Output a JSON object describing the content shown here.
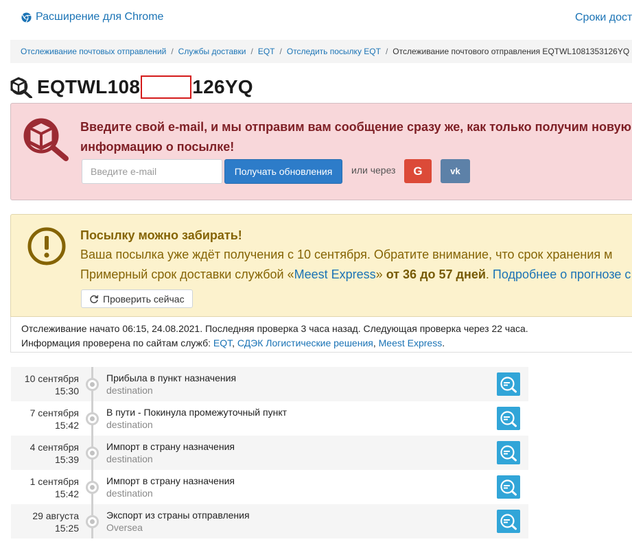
{
  "header": {
    "chrome_extension": "Расширение для Chrome",
    "terms_link": "Сроки доста"
  },
  "breadcrumb": {
    "items": [
      "Отслеживание почтовых отправлений",
      "Службы доставки",
      "EQT",
      "Отследить посылку EQT"
    ],
    "current": "Отслеживание почтового отправления EQTWL1081353126YQ"
  },
  "title": {
    "prefix": "EQTWL108",
    "suffix": "126YQ"
  },
  "subscribe": {
    "message": "Введите свой e-mail, и мы отправим вам сообщение сразу же, как только получим новую информацию о посылке!",
    "email_placeholder": "Введите e-mail",
    "button_label": "Получать обновления",
    "or_via": "или через",
    "google_label": "G",
    "vk_label": "vk"
  },
  "status": {
    "headline": "Посылку можно забирать!",
    "line1": "Ваша посылка уже ждёт получения с 10 сентября. Обратите внимание, что срок хранения м",
    "line2_prefix": "Примерный срок доставки службой «",
    "service": "Meest Express",
    "line2_mid": "» ",
    "duration": "от 36 до 57 дней",
    "line2_suffix": ". ",
    "more_link": "Подробнее о прогнозе с",
    "check_button": "Проверить сейчас"
  },
  "tracking_info": {
    "line1": "Отслеживание начато 06:15, 24.08.2021. Последняя проверка 3 часа назад. Следующая проверка через 22 часа.",
    "line2_prefix": "Информация проверена по сайтам служб: ",
    "services": [
      "EQT",
      "СДЭК Логистические решения",
      "Meest Express"
    ],
    "line2_suffix": "."
  },
  "events": [
    {
      "date": "10 сентября",
      "time": "15:30",
      "title": "Прибыла в пункт назначения",
      "location": "destination"
    },
    {
      "date": "7 сентября",
      "time": "15:42",
      "title": "В пути - Покинула промежуточный пункт",
      "location": "destination"
    },
    {
      "date": "4 сентября",
      "time": "15:39",
      "title": "Импорт в страну назначения",
      "location": "destination"
    },
    {
      "date": "1 сентября",
      "time": "15:42",
      "title": "Импорт в страну назначения",
      "location": "destination"
    },
    {
      "date": "29 августа",
      "time": "15:25",
      "title": "Экспорт из страны отправления",
      "location": "Oversea"
    }
  ],
  "colors": {
    "link": "#1a73b5",
    "alert_pink_bg": "#f8d7da",
    "alert_pink_text": "#7e1f25",
    "alert_yellow_bg": "#fcf2cd",
    "alert_yellow_text": "#856404",
    "primary_button": "#2d7cc9",
    "google_button": "#dc4a38",
    "vk_button": "#5d81a8",
    "event_button": "#31a5d8"
  }
}
